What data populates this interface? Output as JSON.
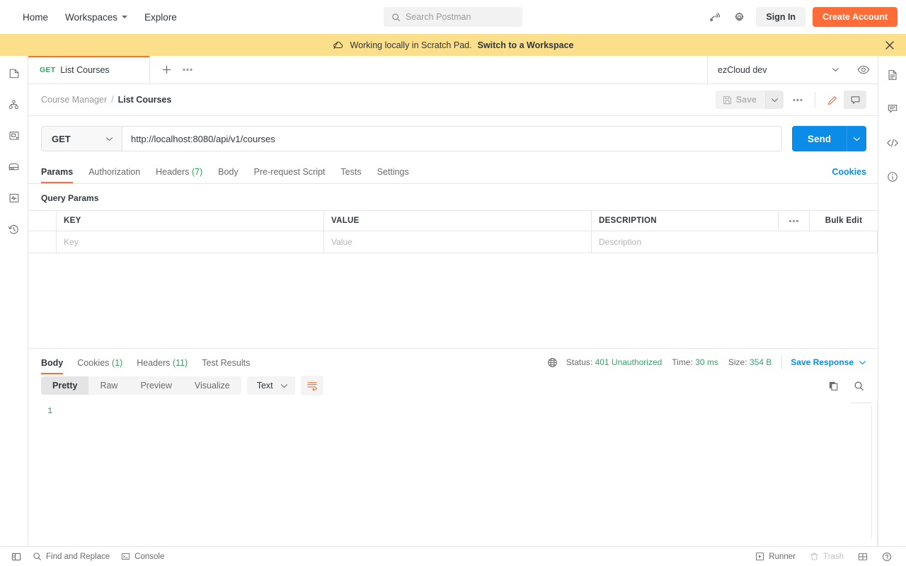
{
  "topnav": {
    "links": [
      {
        "label": "Home",
        "caret": false
      },
      {
        "label": "Workspaces",
        "caret": true
      },
      {
        "label": "Explore",
        "caret": false
      }
    ],
    "search_placeholder": "Search Postman",
    "sign_in_label": "Sign In",
    "create_account_label": "Create Account",
    "accent_color": "#ff6c37"
  },
  "banner": {
    "text": "Working locally in Scratch Pad.",
    "link_label": "Switch to a Workspace",
    "background": "#fbdf8b"
  },
  "left_rail": {
    "items": [
      {
        "name": "collections-icon",
        "title": "Collections"
      },
      {
        "name": "apis-icon",
        "title": "APIs"
      },
      {
        "name": "environments-icon",
        "title": "Environments"
      },
      {
        "name": "mock-servers-icon",
        "title": "Mock Servers"
      },
      {
        "name": "monitors-icon",
        "title": "Monitors"
      },
      {
        "name": "history-icon",
        "title": "History"
      }
    ]
  },
  "right_rail": {
    "items": [
      {
        "name": "documentation-icon",
        "title": "Documentation"
      },
      {
        "name": "comments-icon",
        "title": "Comments"
      },
      {
        "name": "code-snippet-icon",
        "title": "Code snippet"
      },
      {
        "name": "info-icon",
        "title": "Info"
      }
    ]
  },
  "tabstrip": {
    "tabs": [
      {
        "method": "GET",
        "name": "List Courses",
        "active": true
      }
    ],
    "environment": "ezCloud dev"
  },
  "breadcrumb": {
    "parent": "Course Manager",
    "separator": "/",
    "current": "List Courses",
    "save_label": "Save"
  },
  "request": {
    "method": "GET",
    "url": "http://localhost:8080/api/v1/courses",
    "send_label": "Send",
    "tabs": [
      {
        "label": "Params",
        "count": "",
        "active": true
      },
      {
        "label": "Authorization",
        "count": "",
        "active": false
      },
      {
        "label": "Headers",
        "count": "(7)",
        "active": false
      },
      {
        "label": "Body",
        "count": "",
        "active": false
      },
      {
        "label": "Pre-request Script",
        "count": "",
        "active": false
      },
      {
        "label": "Tests",
        "count": "",
        "active": false
      },
      {
        "label": "Settings",
        "count": "",
        "active": false
      }
    ],
    "cookies_link": "Cookies"
  },
  "params": {
    "section_title": "Query Params",
    "columns": [
      "KEY",
      "VALUE",
      "DESCRIPTION"
    ],
    "bulk_edit_label": "Bulk Edit",
    "placeholder_row": {
      "key": "Key",
      "value": "Value",
      "description": "Description"
    }
  },
  "response": {
    "tabs": [
      {
        "label": "Body",
        "count": "",
        "active": true
      },
      {
        "label": "Cookies",
        "count": "(1)",
        "active": false
      },
      {
        "label": "Headers",
        "count": "(11)",
        "active": false
      },
      {
        "label": "Test Results",
        "count": "",
        "active": false
      }
    ],
    "status_label": "Status:",
    "status_value": "401 Unauthorized",
    "time_label": "Time:",
    "time_value": "30 ms",
    "size_label": "Size:",
    "size_value": "354 B",
    "status_color": "#2bab63",
    "save_response_label": "Save Response",
    "format_tabs": [
      {
        "label": "Pretty",
        "active": true
      },
      {
        "label": "Raw",
        "active": false
      },
      {
        "label": "Preview",
        "active": false
      },
      {
        "label": "Visualize",
        "active": false
      }
    ],
    "content_type": "Text",
    "body_lines": [
      "1"
    ],
    "body_content": ""
  },
  "statusbar": {
    "find_and_replace": "Find and Replace",
    "console": "Console",
    "runner": "Runner",
    "trash": "Trash"
  }
}
